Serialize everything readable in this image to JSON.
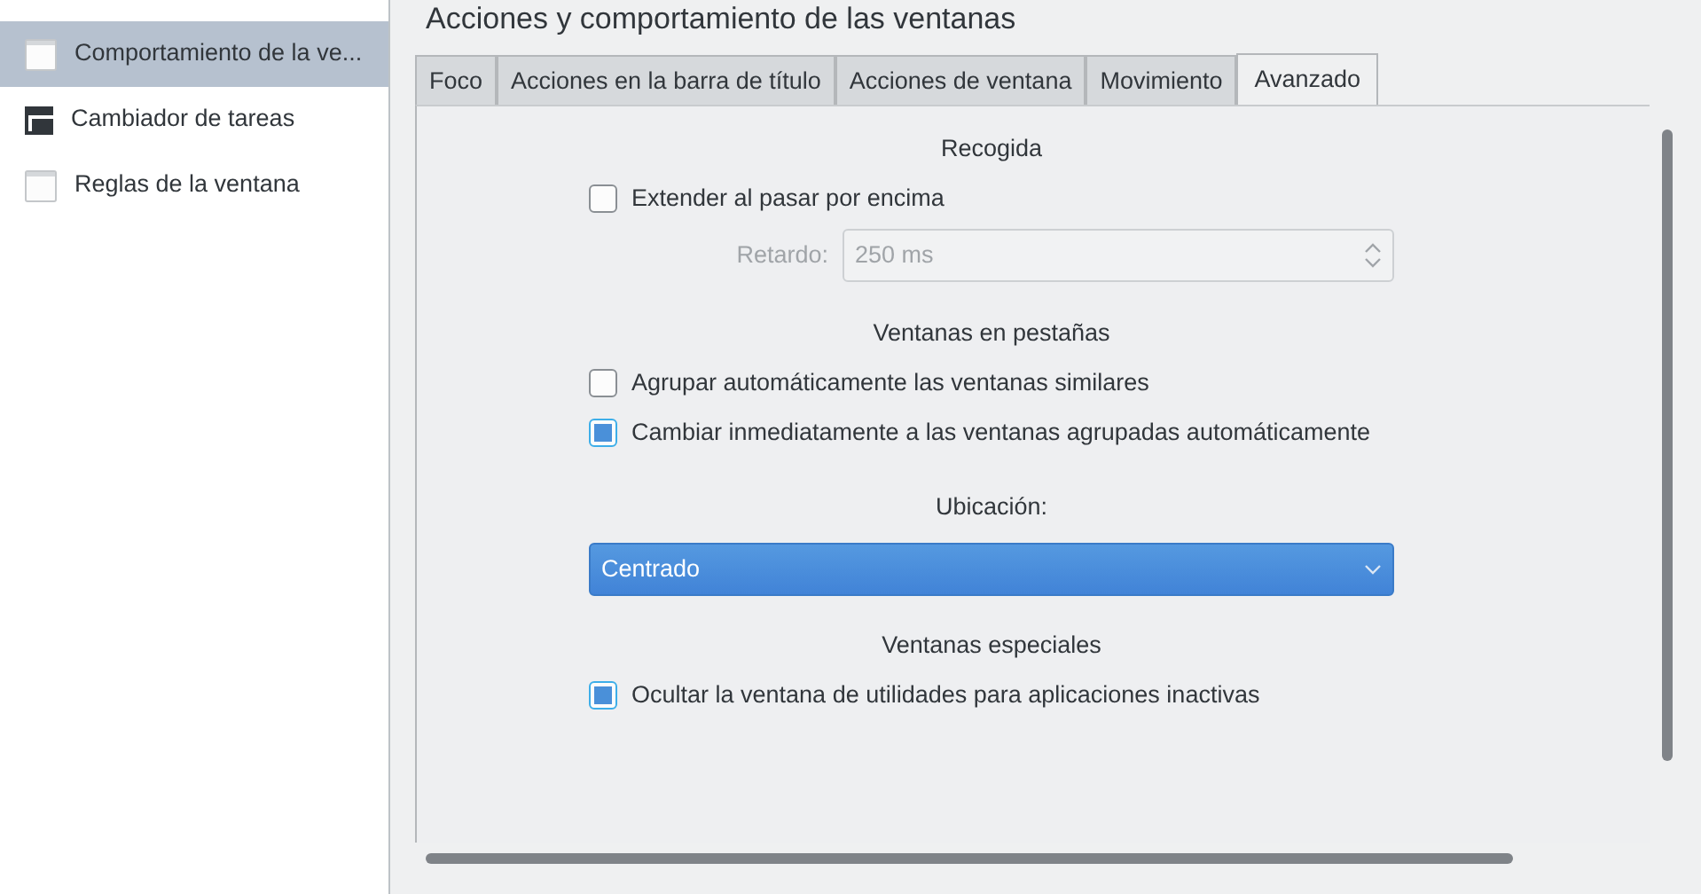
{
  "sidebar": {
    "items": [
      {
        "label": "Comportamiento de la ve...",
        "selected": true
      },
      {
        "label": "Cambiador de tareas",
        "selected": false
      },
      {
        "label": "Reglas de la ventana",
        "selected": false
      }
    ]
  },
  "page_title": "Acciones y comportamiento de las ventanas",
  "tabs": [
    {
      "label": "Foco",
      "selected": false
    },
    {
      "label": "Acciones en la barra de título",
      "selected": false
    },
    {
      "label": "Acciones de ventana",
      "selected": false
    },
    {
      "label": "Movimiento",
      "selected": false
    },
    {
      "label": "Avanzado",
      "selected": true
    }
  ],
  "rows": [
    {
      "kind": "heading",
      "text": "Recogida"
    },
    {
      "kind": "checkbox",
      "label": "Extender al pasar por encima",
      "checked": false
    },
    {
      "kind": "spinbox",
      "label": "Retardo:",
      "value": "250 ms",
      "disabled": true
    },
    {
      "kind": "heading",
      "text": "Ventanas en pestañas"
    },
    {
      "kind": "checkbox",
      "label": "Agrupar automáticamente las ventanas similares",
      "checked": false
    },
    {
      "kind": "checkbox",
      "label": "Cambiar inmediatamente a las ventanas agrupadas automáticamente",
      "checked": true
    },
    {
      "kind": "heading",
      "text": "Ubicación:"
    },
    {
      "kind": "combo",
      "value": "Centrado"
    },
    {
      "kind": "heading",
      "text": "Ventanas especiales"
    },
    {
      "kind": "checkbox",
      "label": "Ocultar la ventana de utilidades para aplicaciones inactivas",
      "checked": true
    }
  ]
}
